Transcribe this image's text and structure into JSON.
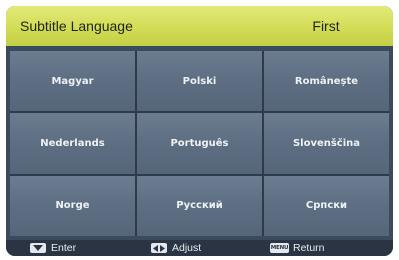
{
  "header": {
    "title": "Subtitle Language",
    "mode": "First"
  },
  "languages": [
    "Magyar",
    "Polski",
    "Românește",
    "Nederlands",
    "Português",
    "Slovenščina",
    "Norge",
    "Русский",
    "Српски"
  ],
  "footer": {
    "enter_label": "Enter",
    "adjust_label": "Adjust",
    "return_label": "Return",
    "menu_icon_text": "MENU",
    "enter_icon": "down-arrow-icon",
    "adjust_icon": "left-right-arrow-icon",
    "return_icon": "menu-key-icon"
  },
  "colors": {
    "header_accent": "#d2dc55",
    "panel": "#3c4a5d",
    "cell": "#5d6e83"
  }
}
